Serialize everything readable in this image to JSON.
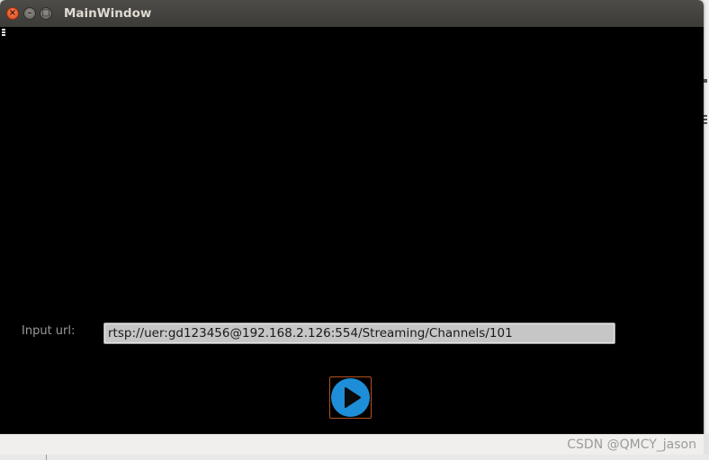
{
  "window": {
    "title": "MainWindow",
    "buttons": {
      "close_icon": "close-icon",
      "minimize_icon": "minimize-icon",
      "maximize_icon": "maximize-icon",
      "close_glyph": "×",
      "minimize_glyph": "–",
      "maximize_glyph": "□"
    }
  },
  "form": {
    "url_label": "Input url:",
    "url_value": "rtsp://uer:gd123456@192.168.2.126:554/Streaming/Channels/101"
  },
  "controls": {
    "play_icon": "play-icon"
  },
  "watermark": "CSDN @QMCY_jason",
  "colors": {
    "titlebar": "#3c3b37",
    "close_button": "#dd4814",
    "play_button": "#1e8ed8",
    "play_border": "#b3511f",
    "video_background": "#000000"
  }
}
